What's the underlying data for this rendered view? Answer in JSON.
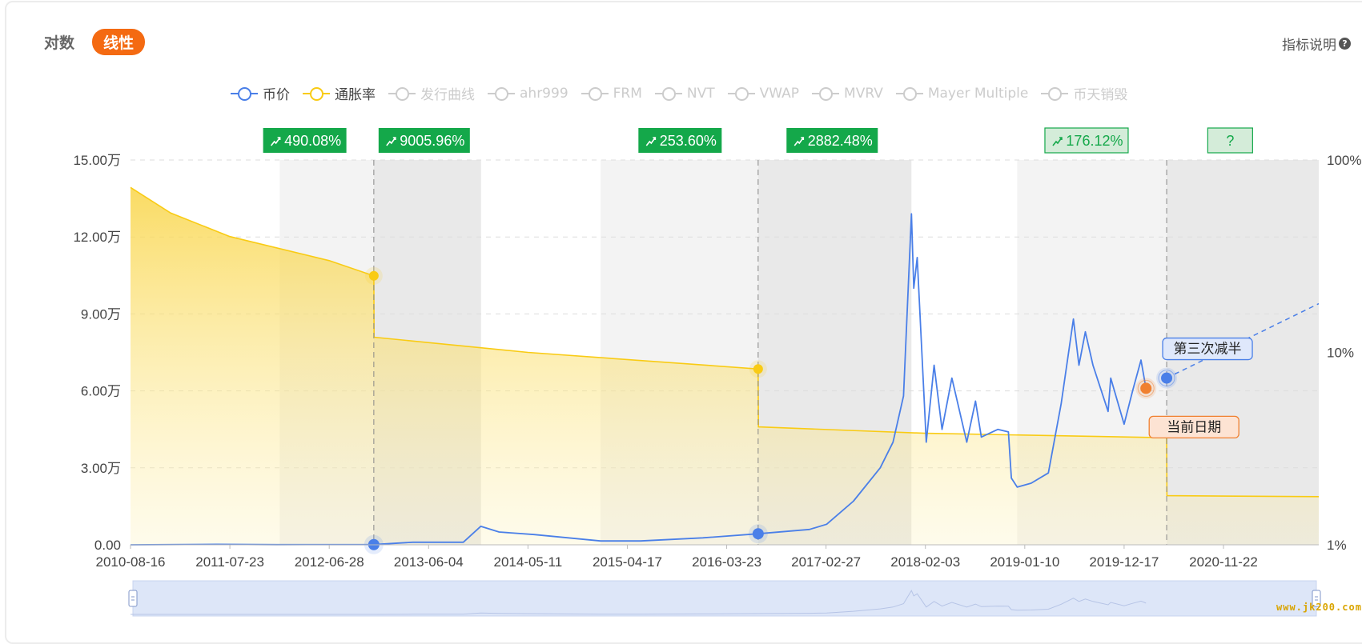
{
  "header": {
    "scale_options": [
      {
        "label": "对数",
        "active": false
      },
      {
        "label": "线性",
        "active": true
      }
    ],
    "help_label": "指标说明",
    "help_icon": "question-circle-icon"
  },
  "legend": [
    {
      "label": "币价",
      "active": true,
      "color": "#4a7fe8"
    },
    {
      "label": "通胀率",
      "active": true,
      "color": "#f9cb14"
    },
    {
      "label": "发行曲线",
      "active": false,
      "color": "#cccccc"
    },
    {
      "label": "ahr999",
      "active": false,
      "color": "#cccccc"
    },
    {
      "label": "FRM",
      "active": false,
      "color": "#cccccc"
    },
    {
      "label": "NVT",
      "active": false,
      "color": "#cccccc"
    },
    {
      "label": "VWAP",
      "active": false,
      "color": "#cccccc"
    },
    {
      "label": "MVRV",
      "active": false,
      "color": "#cccccc"
    },
    {
      "label": "Mayer Multiple",
      "active": false,
      "color": "#cccccc"
    },
    {
      "label": "币天销毁",
      "active": false,
      "color": "#cccccc"
    }
  ],
  "colors": {
    "price": "#4a7fe8",
    "inflation": "#f9cb14",
    "badge_green": "#14a84a",
    "badge_light_bg": "#d4ecd9",
    "current_date": "#f08030",
    "accent_toggle": "#f46a12"
  },
  "watermark": "www.jk200.com",
  "chart_data": {
    "type": "line",
    "title": "",
    "xlabel": "",
    "ylabel": "",
    "x_ticks": [
      "2010-08-16",
      "2011-07-23",
      "2012-06-28",
      "2013-06-04",
      "2014-05-11",
      "2015-04-17",
      "2016-03-23",
      "2017-02-27",
      "2018-02-03",
      "2019-01-10",
      "2019-12-17",
      "2020-11-22"
    ],
    "x_range": [
      "2010-08-16",
      "2021-10-15"
    ],
    "y_left": {
      "ticks": [
        "0.00",
        "3.00万",
        "6.00万",
        "9.00万",
        "12.00万",
        "15.00万"
      ],
      "range": [
        0,
        150000
      ]
    },
    "y_right": {
      "ticks": [
        "1%",
        "10%",
        "100%"
      ],
      "scale": "log",
      "range": [
        1,
        100
      ]
    },
    "grid": true,
    "legend_position": "top",
    "shaded_periods": [
      {
        "start": "2012-01-10",
        "end": "2012-11-28",
        "shade": "light"
      },
      {
        "start": "2012-11-28",
        "end": "2013-12-01",
        "shade": "dark"
      },
      {
        "start": "2015-01-15",
        "end": "2016-07-09",
        "shade": "light"
      },
      {
        "start": "2016-07-09",
        "end": "2017-12-17",
        "shade": "dark"
      },
      {
        "start": "2018-12-15",
        "end": "2020-05-11",
        "shade": "light"
      },
      {
        "start": "2020-05-11",
        "end": "2021-10-15",
        "shade": "dark"
      }
    ],
    "halving_dates": [
      "2012-11-28",
      "2016-07-09",
      "2020-05-11"
    ],
    "cycle_returns": [
      {
        "label": "490.08%",
        "at": "2012-04-05",
        "style": "solid"
      },
      {
        "label": "9005.96%",
        "at": "2013-05-20",
        "style": "solid"
      },
      {
        "label": "253.60%",
        "at": "2015-10-15",
        "style": "solid"
      },
      {
        "label": "2882.48%",
        "at": "2017-03-20",
        "style": "solid"
      },
      {
        "label": "176.12%",
        "at": "2019-08-10",
        "style": "outline"
      },
      {
        "label": "?",
        "at": "2020-12-15",
        "style": "outline"
      }
    ],
    "series": [
      {
        "name": "币价",
        "axis": "left",
        "points": [
          [
            "2010-08-16",
            5
          ],
          [
            "2011-06-08",
            200
          ],
          [
            "2012-01-01",
            50
          ],
          [
            "2012-11-28",
            80
          ],
          [
            "2013-04-10",
            1000
          ],
          [
            "2013-10-01",
            1000
          ],
          [
            "2013-11-30",
            7200
          ],
          [
            "2014-02-01",
            5000
          ],
          [
            "2014-06-01",
            4000
          ],
          [
            "2015-01-15",
            1500
          ],
          [
            "2015-06-01",
            1500
          ],
          [
            "2016-01-01",
            2700
          ],
          [
            "2016-07-09",
            4300
          ],
          [
            "2017-01-01",
            6000
          ],
          [
            "2017-03-01",
            8000
          ],
          [
            "2017-06-01",
            17000
          ],
          [
            "2017-09-01",
            30000
          ],
          [
            "2017-10-15",
            40000
          ],
          [
            "2017-11-20",
            58000
          ],
          [
            "2017-12-17",
            129000
          ],
          [
            "2017-12-25",
            100000
          ],
          [
            "2018-01-06",
            112000
          ],
          [
            "2018-02-06",
            40000
          ],
          [
            "2018-03-05",
            70000
          ],
          [
            "2018-04-01",
            45000
          ],
          [
            "2018-05-05",
            65000
          ],
          [
            "2018-06-25",
            40000
          ],
          [
            "2018-07-25",
            56000
          ],
          [
            "2018-08-14",
            42000
          ],
          [
            "2018-10-10",
            45000
          ],
          [
            "2018-11-15",
            44000
          ],
          [
            "2018-11-25",
            26000
          ],
          [
            "2018-12-15",
            22500
          ],
          [
            "2019-02-01",
            24000
          ],
          [
            "2019-04-01",
            28000
          ],
          [
            "2019-05-15",
            55000
          ],
          [
            "2019-06-26",
            88000
          ],
          [
            "2019-07-15",
            70000
          ],
          [
            "2019-08-06",
            83000
          ],
          [
            "2019-09-01",
            70000
          ],
          [
            "2019-10-23",
            52000
          ],
          [
            "2019-11-01",
            65000
          ],
          [
            "2019-12-17",
            47000
          ],
          [
            "2020-01-15",
            60000
          ],
          [
            "2020-02-13",
            72000
          ],
          [
            "2020-03-01",
            61000
          ]
        ]
      },
      {
        "name": "通胀率",
        "axis": "right",
        "points": [
          [
            "2010-08-16",
            72
          ],
          [
            "2011-01-01",
            53
          ],
          [
            "2011-07-23",
            40
          ],
          [
            "2012-06-28",
            30
          ],
          [
            "2012-11-28",
            25
          ],
          [
            "2012-11-29",
            12
          ],
          [
            "2014-05-11",
            10
          ],
          [
            "2016-07-09",
            8.2
          ],
          [
            "2016-07-10",
            4.1
          ],
          [
            "2018-02-03",
            3.8
          ],
          [
            "2020-05-11",
            3.6
          ],
          [
            "2020-05-12",
            1.8
          ],
          [
            "2021-10-15",
            1.78
          ]
        ]
      }
    ],
    "annotations": [
      {
        "label": "第三次减半",
        "date": "2020-05-11",
        "value": 65000,
        "color": "#4a7fe8"
      },
      {
        "label": "当前日期",
        "date": "2020-03-01",
        "value": 61000,
        "color": "#f08030"
      }
    ],
    "projection": {
      "from": [
        "2020-05-11",
        65000
      ],
      "to": [
        "2021-10-15",
        94000
      ]
    },
    "zoom_range": [
      0,
      1
    ]
  }
}
